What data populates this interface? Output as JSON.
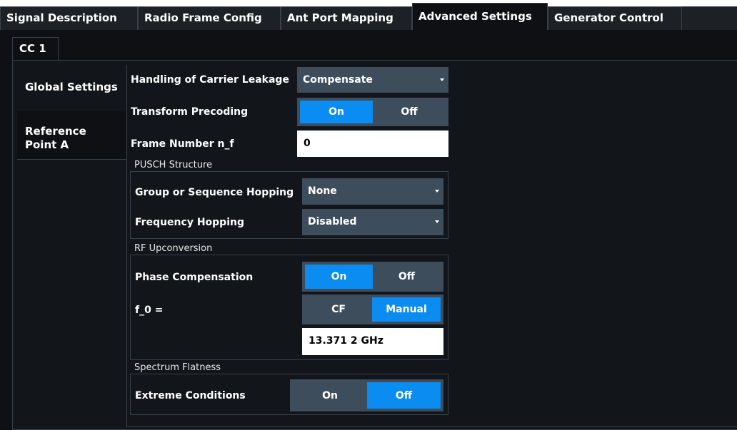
{
  "tabs": [
    {
      "label": "Signal Description"
    },
    {
      "label": "Radio Frame Config"
    },
    {
      "label": "Ant Port Mapping"
    },
    {
      "label": "Advanced Settings"
    },
    {
      "label": "Generator Control"
    }
  ],
  "cc_tab": "CC 1",
  "side_tabs": [
    {
      "label": "Global Settings"
    },
    {
      "label": "Reference Point A"
    }
  ],
  "global": {
    "carrier_leakage": {
      "label": "Handling of Carrier Leakage",
      "value": "Compensate"
    },
    "transform_precoding": {
      "label": "Transform Precoding",
      "on": "On",
      "off": "Off",
      "selected": "On"
    },
    "frame_number": {
      "label": "Frame Number n_f",
      "value": "0"
    }
  },
  "pusch": {
    "title": "PUSCH Structure",
    "group_hopping": {
      "label": "Group or Sequence Hopping",
      "value": "None"
    },
    "freq_hopping": {
      "label": "Frequency Hopping",
      "value": "Disabled"
    }
  },
  "rf": {
    "title": "RF Upconversion",
    "phase_comp": {
      "label": "Phase Compensation",
      "on": "On",
      "off": "Off",
      "selected": "On"
    },
    "f0": {
      "label": "f_0 =",
      "cf": "CF",
      "manual": "Manual",
      "selected": "Manual",
      "value": "13.371 2 GHz"
    }
  },
  "flatness": {
    "title": "Spectrum Flatness",
    "extreme": {
      "label": "Extreme Conditions",
      "on": "On",
      "off": "Off",
      "selected": "Off"
    }
  },
  "colors": {
    "accent": "#0a8cf0",
    "control_bg": "#3d4d5c",
    "panel_bg": "#121519",
    "background": "#0e1013"
  }
}
